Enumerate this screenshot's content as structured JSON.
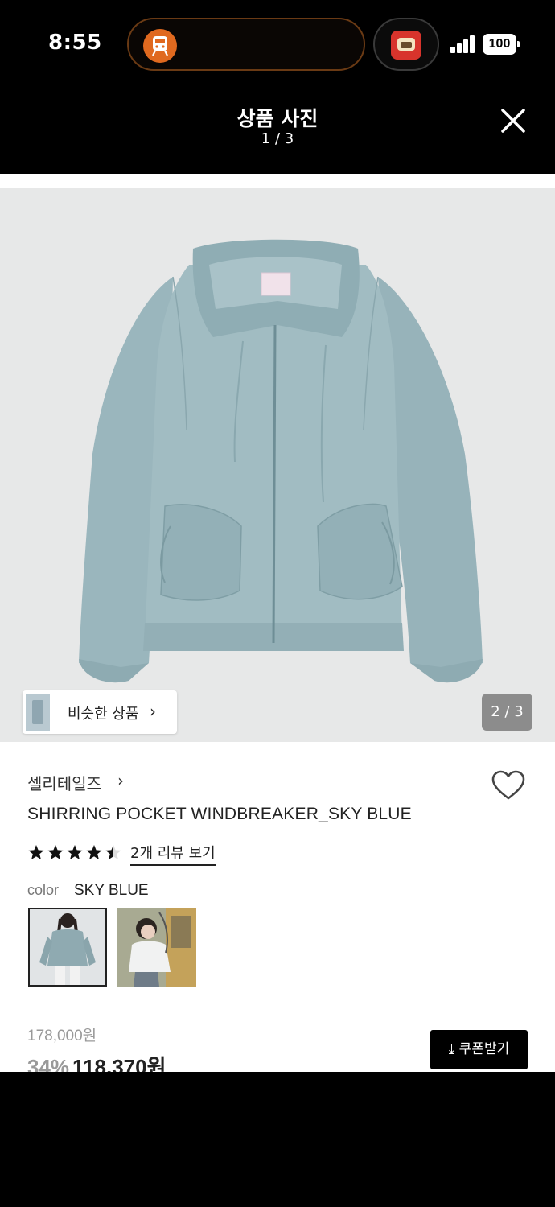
{
  "status_bar": {
    "time": "8:55",
    "battery": "100",
    "live_activity_icon": "train-icon",
    "app_icon": "app-icon"
  },
  "header": {
    "title": "상품 사진",
    "counter": "1 / 3",
    "close_icon": "close-icon"
  },
  "photo": {
    "similar_label": "비슷한 상품",
    "page_indicator": "2 / 3",
    "jacket_color": "#9ab6bd",
    "background_color": "#e7e8e8"
  },
  "product": {
    "brand": "셀리테일즈",
    "name": "SHIRRING POCKET WINDBREAKER_SKY BLUE",
    "rating": 4.5,
    "review_link": "2개 리뷰 보기",
    "color_label": "color",
    "color_value": "SKY BLUE",
    "original_price": "178,000원",
    "discount": "34%",
    "sale_price": "118,370원",
    "coupon_label": "쿠폰받기"
  }
}
